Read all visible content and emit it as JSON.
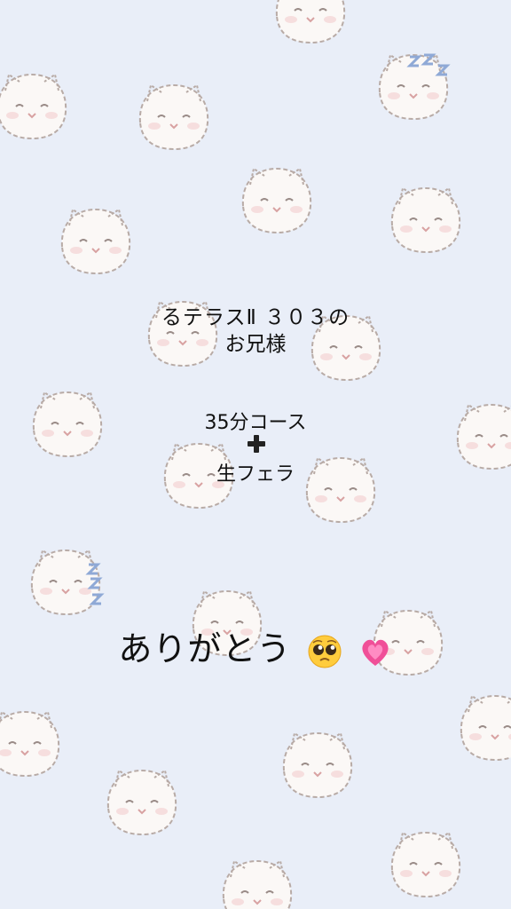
{
  "message": {
    "line1": "るテラスⅡ ３０３の",
    "line2": "お兄様",
    "course": "35分コース",
    "option": "生フェラ",
    "thanks": "ありがとう"
  },
  "emojis": [
    "pleading-face-icon",
    "growing-heart-icon"
  ],
  "colors": {
    "background": "#e9eef8",
    "text": "#111111",
    "cat_fill": "#fbf8f6",
    "cat_outline": "#b8aba6",
    "zzz": "#8fa9d6"
  }
}
